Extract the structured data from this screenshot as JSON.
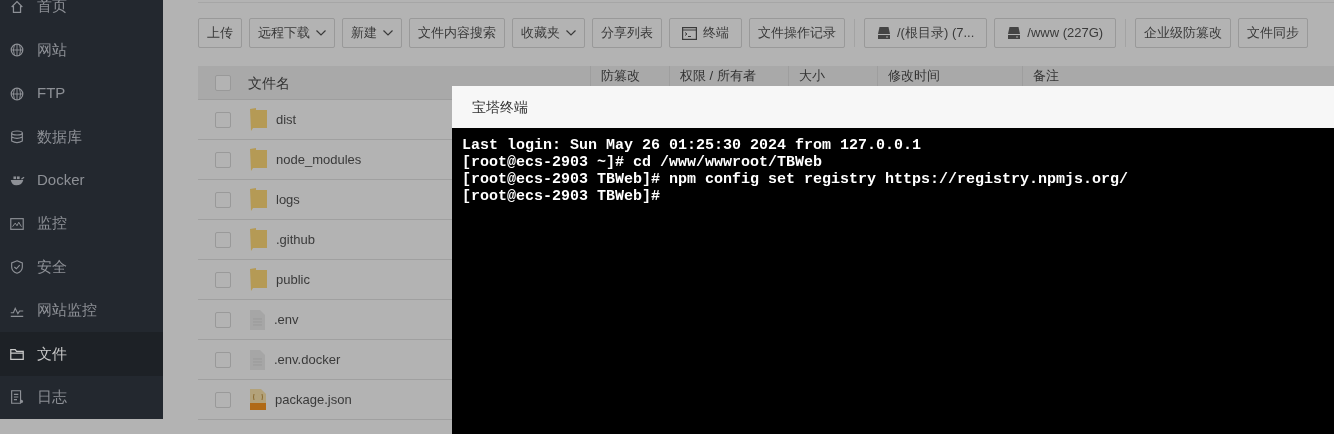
{
  "sidebar": {
    "items": [
      {
        "label": "首页",
        "selected": false
      },
      {
        "label": "网站",
        "selected": false
      },
      {
        "label": "FTP",
        "selected": false
      },
      {
        "label": "数据库",
        "selected": false
      },
      {
        "label": "Docker",
        "selected": false
      },
      {
        "label": "监控",
        "selected": false
      },
      {
        "label": "安全",
        "selected": false
      },
      {
        "label": "网站监控",
        "selected": false
      },
      {
        "label": "文件",
        "selected": true
      },
      {
        "label": "日志",
        "selected": false
      }
    ]
  },
  "toolbar": {
    "groups": [
      {
        "buttons": [
          {
            "label": "上传",
            "kind": "plain"
          },
          {
            "label": "远程下载",
            "kind": "dropdown"
          },
          {
            "label": "新建",
            "kind": "dropdown"
          },
          {
            "label": "文件内容搜索",
            "kind": "plain"
          },
          {
            "label": "收藏夹",
            "kind": "dropdown"
          },
          {
            "label": "分享列表",
            "kind": "plain"
          },
          {
            "label": "终端",
            "kind": "terminal"
          },
          {
            "label": "文件操作记录",
            "kind": "plain"
          }
        ]
      },
      {
        "buttons": [
          {
            "label": "/(根目录) (7...",
            "kind": "disk"
          },
          {
            "label": "/www (227G)",
            "kind": "disk"
          }
        ]
      },
      {
        "buttons": [
          {
            "label": "企业级防篡改",
            "kind": "plain"
          },
          {
            "label": "文件同步",
            "kind": "plain"
          }
        ]
      }
    ]
  },
  "table": {
    "columns": [
      "文件名",
      "防篡改",
      "权限 / 所有者",
      "大小",
      "修改时间",
      "备注"
    ],
    "header_checked": false,
    "rows": [
      {
        "name": "dist",
        "kind": "folder",
        "checked": false
      },
      {
        "name": "node_modules",
        "kind": "folder",
        "checked": false
      },
      {
        "name": "logs",
        "kind": "folder",
        "checked": false
      },
      {
        "name": ".github",
        "kind": "folder",
        "checked": false
      },
      {
        "name": "public",
        "kind": "folder",
        "checked": false
      },
      {
        "name": ".env",
        "kind": "file",
        "checked": false
      },
      {
        "name": ".env.docker",
        "kind": "file",
        "checked": false
      },
      {
        "name": "package.json",
        "kind": "json",
        "checked": false
      }
    ]
  },
  "terminal_dialog": {
    "title": "宝塔终端",
    "lines": [
      "Last login: Sun May 26 01:25:30 2024 from 127.0.0.1",
      "[root@ecs-2903 ~]# cd /www/wwwroot/TBWeb",
      "[root@ecs-2903 TBWeb]# npm config set registry https://registry.npmjs.org/",
      "[root@ecs-2903 TBWeb]#"
    ]
  }
}
